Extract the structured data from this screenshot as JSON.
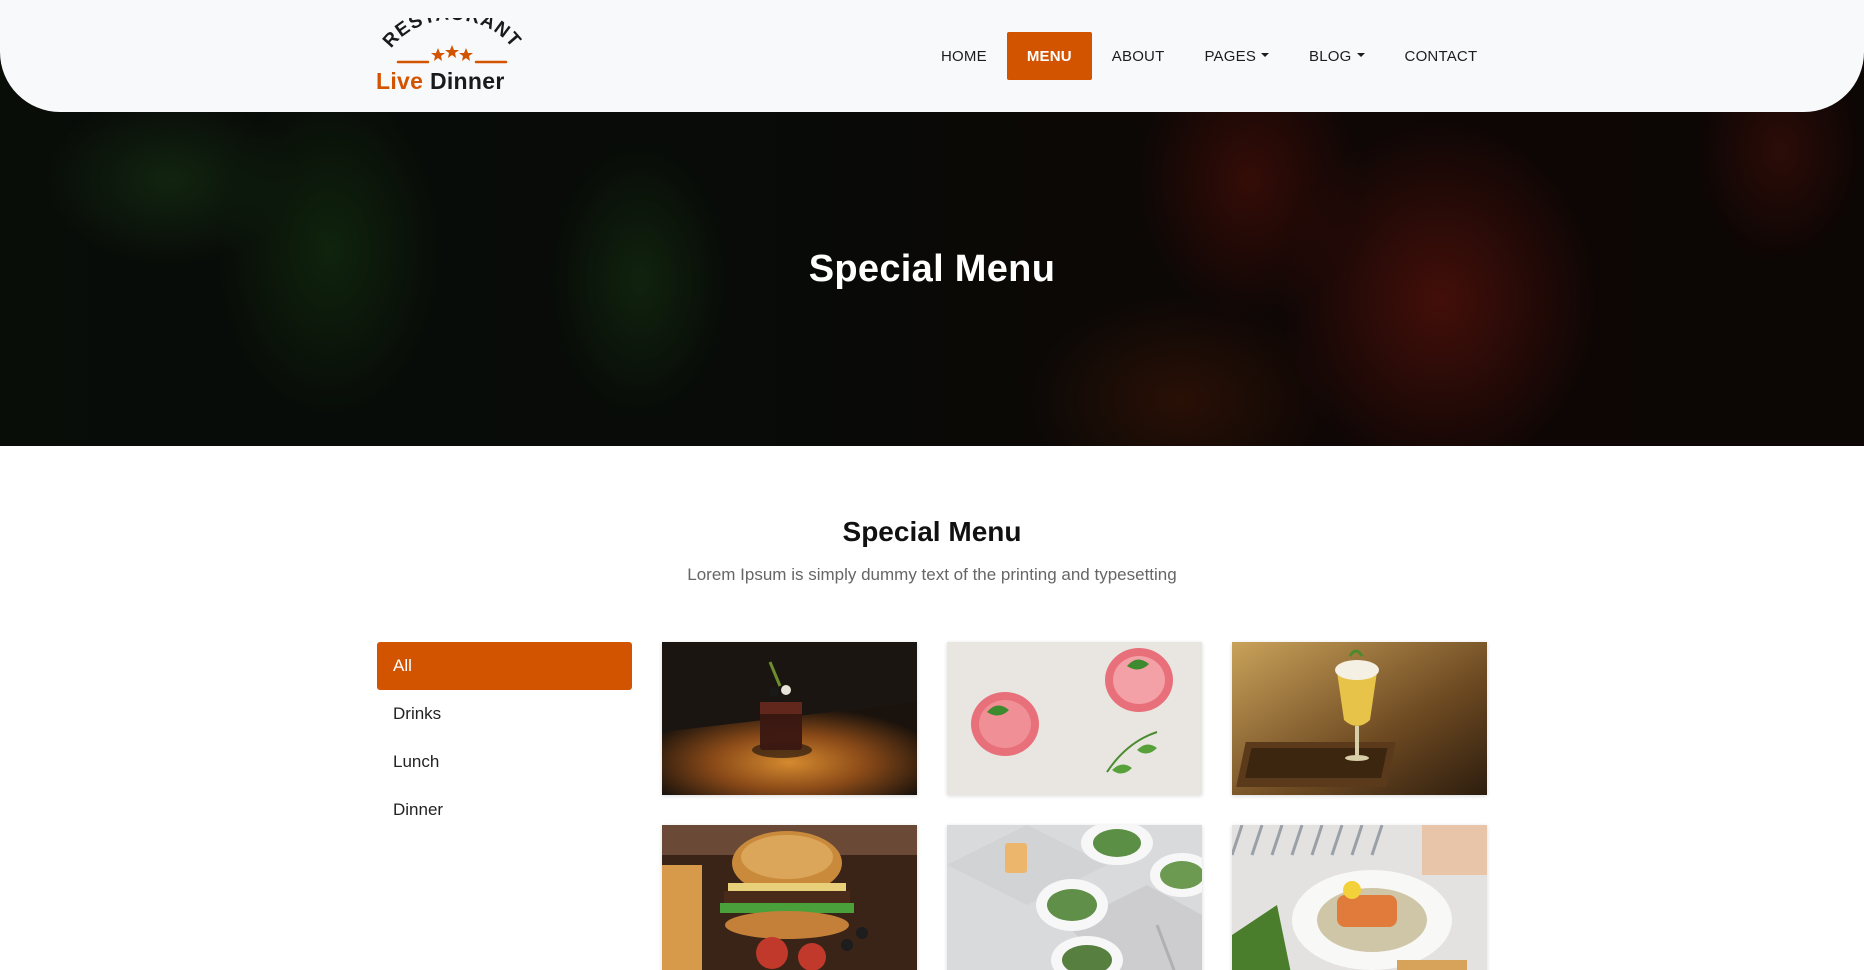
{
  "brand": {
    "arc_text": "RESTAURANT",
    "name_part1": "Live",
    "name_part2": "Dinner"
  },
  "nav": {
    "items": [
      {
        "label": "HOME",
        "active": false,
        "dropdown": false
      },
      {
        "label": "MENU",
        "active": true,
        "dropdown": false
      },
      {
        "label": "ABOUT",
        "active": false,
        "dropdown": false
      },
      {
        "label": "PAGES",
        "active": false,
        "dropdown": true
      },
      {
        "label": "BLOG",
        "active": false,
        "dropdown": true
      },
      {
        "label": "CONTACT",
        "active": false,
        "dropdown": false
      }
    ]
  },
  "hero": {
    "title": "Special Menu"
  },
  "section": {
    "title": "Special Menu",
    "subtitle": "Lorem Ipsum is simply dummy text of the printing and typesetting"
  },
  "filters": [
    {
      "label": "All",
      "active": true
    },
    {
      "label": "Drinks",
      "active": false
    },
    {
      "label": "Lunch",
      "active": false
    },
    {
      "label": "Dinner",
      "active": false
    }
  ],
  "gallery": [
    {
      "subject": "cocktail-on-wooden-table"
    },
    {
      "subject": "pink-drinks-with-mint"
    },
    {
      "subject": "beer-glass-on-tray"
    },
    {
      "subject": "burger-with-fries"
    },
    {
      "subject": "salad-plates"
    },
    {
      "subject": "salmon-dish"
    }
  ],
  "colors": {
    "accent": "#d35400",
    "header_bg": "#f8f9fa"
  }
}
